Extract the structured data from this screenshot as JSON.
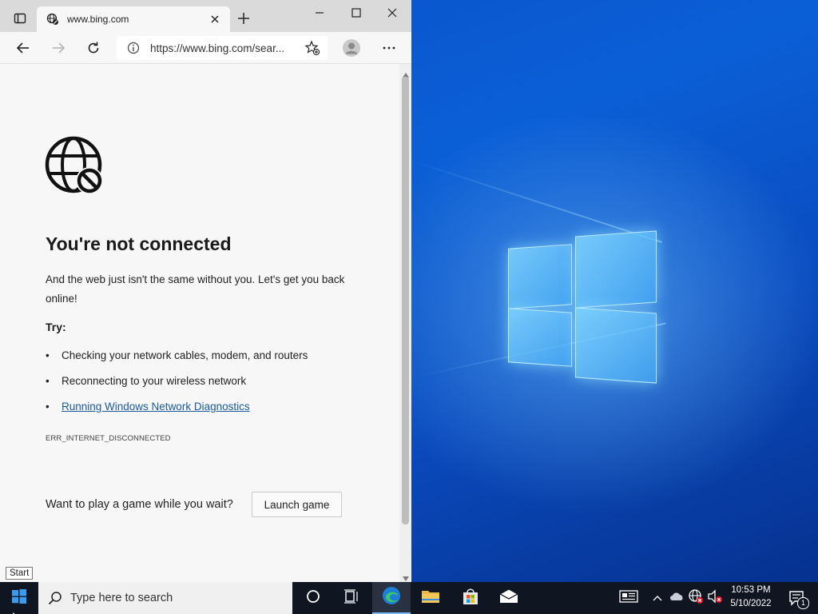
{
  "browser": {
    "tab_title": "www.bing.com",
    "address": "https://www.bing.com/sear...",
    "icons": [
      "tab-actions-icon",
      "close-icon",
      "new-tab-icon",
      "minimize-icon",
      "maximize-icon",
      "back-icon",
      "forward-icon",
      "refresh-icon",
      "info-icon",
      "add-favorite-icon",
      "profile-icon",
      "more-icon"
    ]
  },
  "error_page": {
    "heading": "You're not connected",
    "description": "And the web just isn't the same without you. Let's get you back online!",
    "try_label": "Try:",
    "suggestions": [
      "Checking your network cables, modem, and routers",
      "Reconnecting to your wireless network",
      "Running Windows Network Diagnostics"
    ],
    "error_code": "ERR_INTERNET_DISCONNECTED",
    "game_prompt": "Want to play a game while you wait?",
    "game_button": "Launch game"
  },
  "tooltip": "Start",
  "taskbar": {
    "search_placeholder": "Type here to search",
    "time": "10:53 PM",
    "date": "5/10/2022",
    "notification_count": "1"
  },
  "colors": {
    "accent_link": "#1a5a9c",
    "taskbar_bg": "#101522",
    "desktop_blue": "#0a4fc8"
  }
}
